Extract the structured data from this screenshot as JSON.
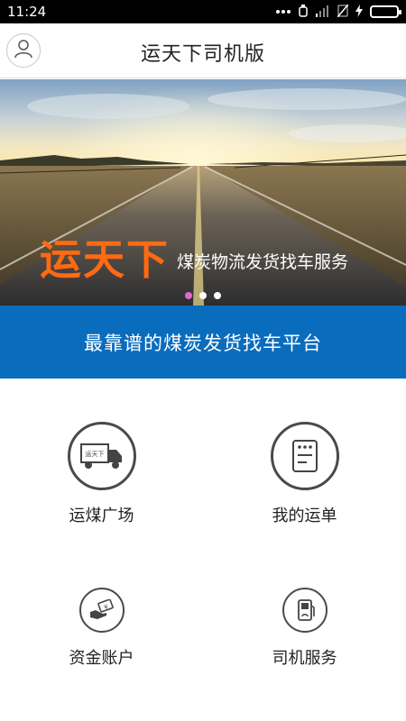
{
  "status_bar": {
    "time": "11:24",
    "icons": [
      "more-icon",
      "alarm-icon",
      "signal-icon",
      "no-sim-icon",
      "charging-icon",
      "battery-icon"
    ],
    "battery_color": "#4cd964"
  },
  "header": {
    "title": "运天下司机版",
    "avatar_icon": "user-icon"
  },
  "banner": {
    "brand": "运天下",
    "tagline": "煤炭物流发货找车服务",
    "active_slide": 1,
    "slide_count": 3,
    "brand_color": "#ff6a13"
  },
  "slogan": {
    "text": "最靠谱的煤炭发货找车平台",
    "background": "#0a6cbd"
  },
  "menu": {
    "items": [
      {
        "label": "运煤广场",
        "icon": "truck-icon"
      },
      {
        "label": "我的运单",
        "icon": "waybill-icon"
      },
      {
        "label": "资金账户",
        "icon": "money-hand-icon"
      },
      {
        "label": "司机服务",
        "icon": "fuel-pump-icon"
      }
    ],
    "truck_badge": "运天下"
  }
}
